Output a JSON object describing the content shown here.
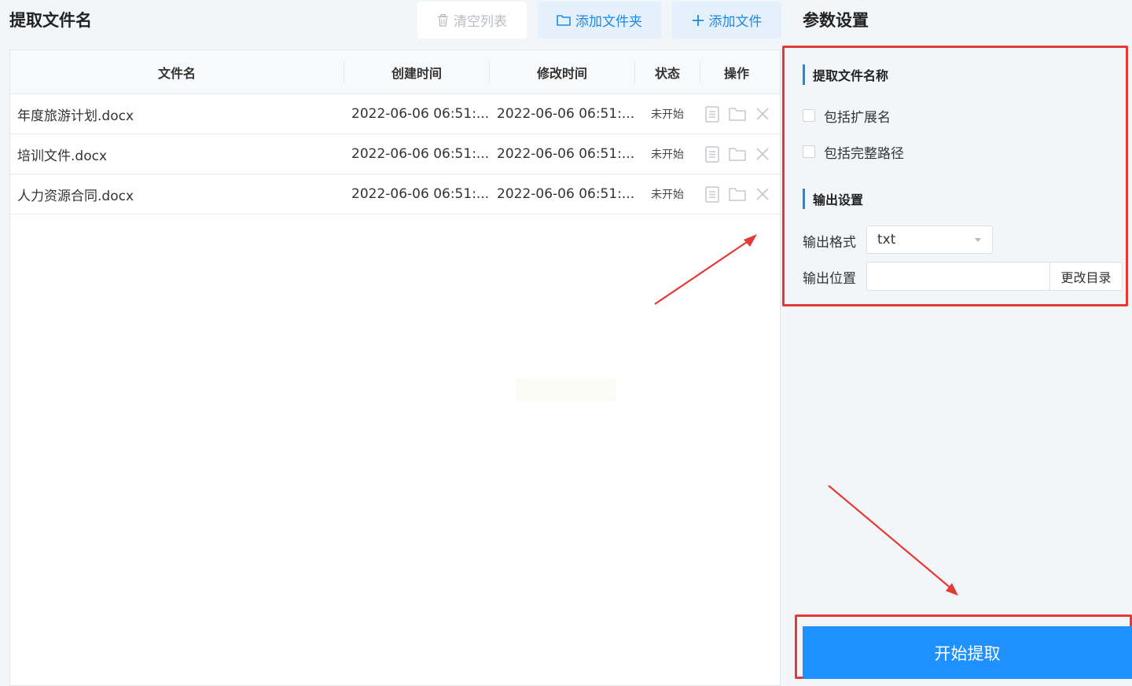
{
  "left_panel": {
    "title": "提取文件名",
    "toolbar": {
      "clear_label": "清空列表",
      "add_folder_label": "添加文件夹",
      "add_file_label": "添加文件"
    },
    "table": {
      "columns": [
        "文件名",
        "创建时间",
        "修改时间",
        "状态",
        "操作"
      ],
      "rows": [
        {
          "name": "年度旅游计划.docx",
          "created": "2022-06-06 06:51:...",
          "modified": "2022-06-06 06:51:...",
          "status": "未开始"
        },
        {
          "name": "培训文件.docx",
          "created": "2022-06-06 06:51:...",
          "modified": "2022-06-06 06:51:...",
          "status": "未开始"
        },
        {
          "name": "人力资源合同.docx",
          "created": "2022-06-06 06:51:...",
          "modified": "2022-06-06 06:51:...",
          "status": "未开始"
        }
      ],
      "row_actions": [
        "document-icon",
        "folder-icon",
        "close-icon"
      ]
    }
  },
  "settings": {
    "title": "参数设置",
    "section_name": {
      "title": "提取文件名称",
      "include_ext_label": "包括扩展名",
      "include_ext_checked": false,
      "include_path_label": "包括完整路径",
      "include_path_checked": false
    },
    "section_output": {
      "title": "输出设置",
      "format_label": "输出格式",
      "format_value": "txt",
      "location_label": "输出位置",
      "location_value": "",
      "change_dir_label": "更改目录"
    },
    "start_label": "开始提取"
  },
  "colors": {
    "accent": "#1e88e5",
    "start_button": "#1e90ff",
    "annotation_red": "#e53935"
  }
}
